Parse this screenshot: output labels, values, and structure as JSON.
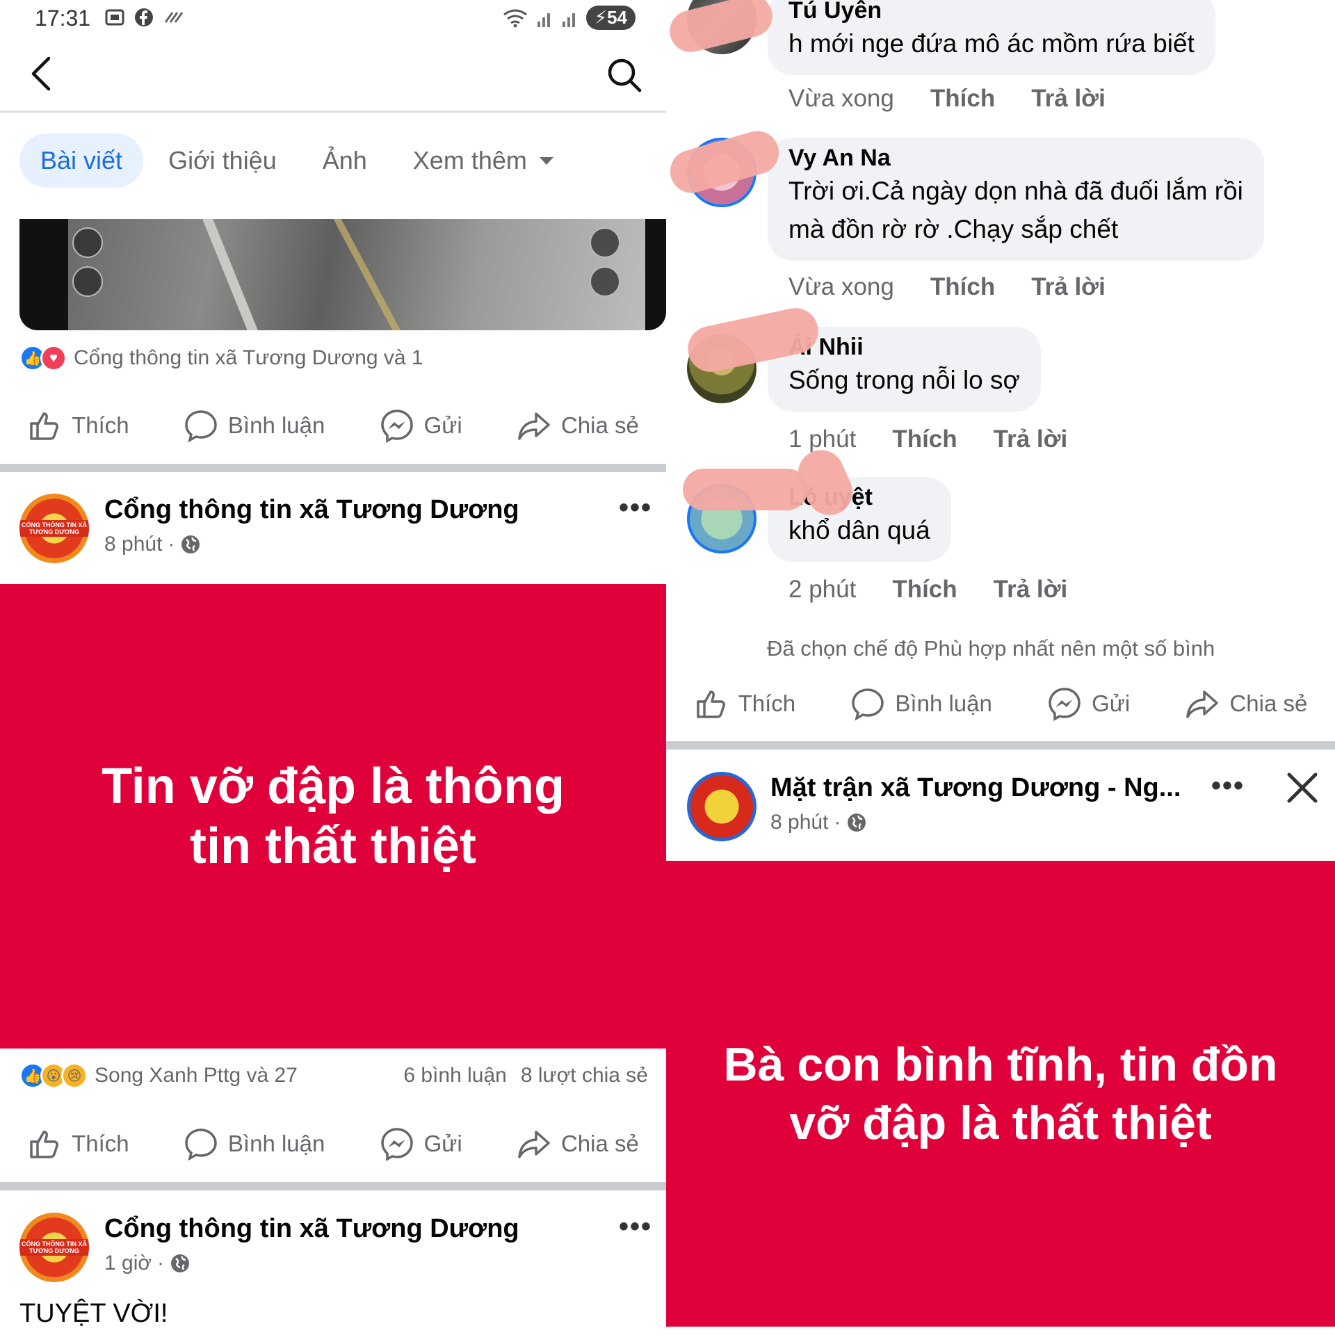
{
  "status_bar": {
    "time": "17:31",
    "battery": "54",
    "icons": [
      "screenshot-icon",
      "facebook-icon",
      "data-icon",
      "wifi-icon",
      "signal-icon",
      "signal-icon"
    ]
  },
  "left": {
    "tabs": [
      {
        "label": "Bài viết",
        "active": true
      },
      {
        "label": "Giới thiệu"
      },
      {
        "label": "Ảnh"
      },
      {
        "label": "Xem thêm"
      }
    ],
    "post1": {
      "reactions_text": "Cổng thông tin xã Tương Dương và 1"
    },
    "actions": {
      "like": "Thích",
      "comment": "Bình luận",
      "send": "Gửi",
      "share": "Chia sẻ"
    },
    "post2": {
      "author": "Cổng thông tin xã Tương Dương",
      "time": "8 phút",
      "avatar_text": "CỔNG THÔNG TIN XÃ TƯƠNG DƯƠNG",
      "card_text": "Tin vỡ đập là thông tin thất thiệt",
      "reactions_text": "Song Xanh Pttg và 27",
      "comments_count": "6 bình luận",
      "shares_count": "8 lượt chia sẻ"
    },
    "post3": {
      "author": "Cổng thông tin xã Tương Dương",
      "time": "1 giờ",
      "avatar_text": "CỔNG THÔNG TIN XÃ TƯƠNG DƯƠNG",
      "text": "TUYỆT VỜI!"
    }
  },
  "right": {
    "comments": [
      {
        "name": "Tú Uyên",
        "lines": [
          "h mới nge đứa mô ác mồm rứa biết"
        ],
        "time": "Vừa xong",
        "like": "Thích",
        "reply": "Trả lời"
      },
      {
        "name": "Vy An Na",
        "lines": [
          "Trời ơi.Cả ngày dọn nhà đã đuối lắm rồi",
          "mà đồn rờ rờ .Chạy sắp chết"
        ],
        "time": "Vừa xong",
        "like": "Thích",
        "reply": "Trả lời"
      },
      {
        "name": "Ái Nhii",
        "lines": [
          "Sống trong nỗi lo sợ"
        ],
        "time": "1 phút",
        "like": "Thích",
        "reply": "Trả lời"
      },
      {
        "name": "Ló     uyệt",
        "lines": [
          "khổ dân quá"
        ],
        "time": "2 phút",
        "like": "Thích",
        "reply": "Trả lời"
      }
    ],
    "notice": "Đã chọn chế độ Phù hợp nhất nên một số bình",
    "actions": {
      "like": "Thích",
      "comment": "Bình luận",
      "send": "Gửi",
      "share": "Chia sẻ"
    },
    "post": {
      "author": "Mặt trận xã Tương Dương - Ng...",
      "time": "8 phút",
      "card_text": "Bà con bình tĩnh, tin đồn vỡ đập là thất thiệt"
    }
  },
  "colors": {
    "accent": "#1877f2",
    "card_red": "#e0003a",
    "secondary_text": "#65676b",
    "bubble": "#f0f2f5",
    "redaction": "#f4a9a3"
  }
}
